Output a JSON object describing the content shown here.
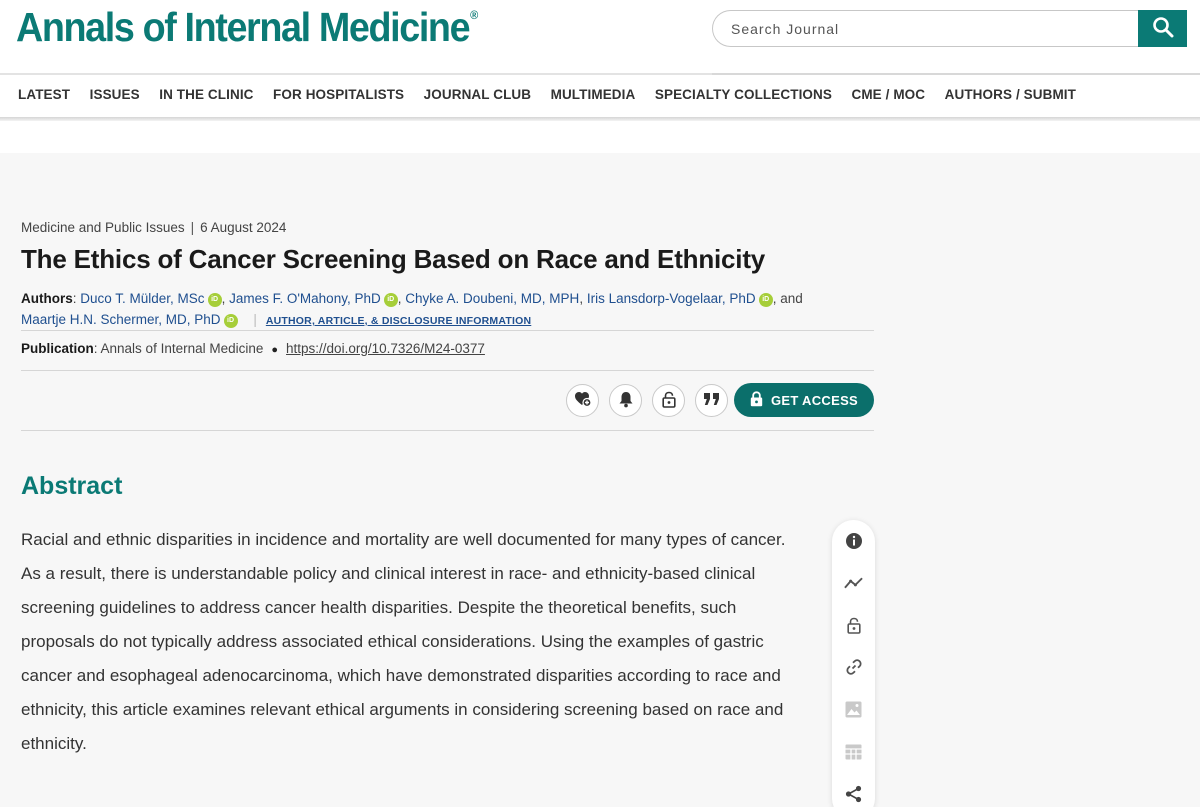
{
  "header": {
    "logo_text": "Annals of Internal Medicine",
    "logo_mark": "®",
    "search_placeholder": "Search Journal",
    "brand_color": "#0b7a75"
  },
  "nav": {
    "items": [
      "LATEST",
      "ISSUES",
      "IN THE CLINIC",
      "FOR HOSPITALISTS",
      "JOURNAL CLUB",
      "MULTIMEDIA",
      "SPECIALTY COLLECTIONS",
      "CME / MOC",
      "AUTHORS / SUBMIT"
    ]
  },
  "article": {
    "section": "Medicine and Public Issues",
    "separator": "|",
    "date": "6 August 2024",
    "title": "The Ethics of Cancer Screening Based on Race and Ethnicity",
    "authors_label": "Authors",
    "authors": [
      "Duco T. Mülder, MSc",
      "James F. O'Mahony, PhD",
      "Chyke A. Doubeni, MD, MPH",
      "Iris Lansdorp-Vogelaar, PhD",
      "Maartje H.N. Schermer, MD, PhD"
    ],
    "and_text": "and",
    "orcid_label": "iD",
    "disclosure_link": "AUTHOR, ARTICLE, & DISCLOSURE INFORMATION",
    "publication_label": "Publication",
    "publication": "Annals of Internal Medicine",
    "doi": "https://doi.org/10.7326/M24-0377",
    "get_access": "GET ACCESS"
  },
  "tools": {
    "icons": [
      "favorite-add-icon",
      "alert-bell-icon",
      "lock-icon",
      "quote-icon"
    ]
  },
  "abstract": {
    "heading": "Abstract",
    "text": "Racial and ethnic disparities in incidence and mortality are well documented for many types of cancer. As a result, there is understandable policy and clinical interest in race- and ethnicity-based clinical screening guidelines to address cancer health disparities. Despite the theoretical benefits, such proposals do not typically address associated ethical considerations. Using the examples of gastric cancer and esophageal adenocarcinoma, which have demonstrated disparities according to race and ethnicity, this article examines relevant ethical arguments in considering screening based on race and ethnicity."
  },
  "side_rail": {
    "icons": [
      "info-icon",
      "metrics-icon",
      "lock-icon",
      "link-icon",
      "image-icon",
      "table-icon",
      "share-icon"
    ]
  }
}
